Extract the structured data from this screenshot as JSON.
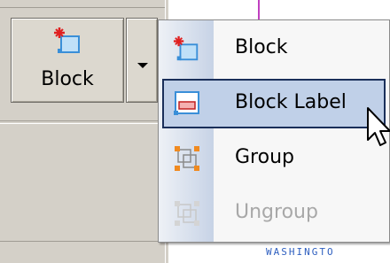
{
  "toolbar": {
    "block_button": {
      "label": "Block",
      "icon": "block-icon"
    },
    "dropdown_icon": "dropdown-arrow-icon"
  },
  "menu": {
    "items": [
      {
        "label": "Block",
        "icon": "block-icon",
        "enabled": true,
        "highlighted": false
      },
      {
        "label": "Block Label",
        "icon": "block-label-icon",
        "enabled": true,
        "highlighted": true
      },
      {
        "label": "Group",
        "icon": "group-icon",
        "enabled": true,
        "highlighted": false
      },
      {
        "label": "Ungroup",
        "icon": "ungroup-icon",
        "enabled": false,
        "highlighted": false
      }
    ]
  },
  "canvas": {
    "text": "WASHINGTO"
  },
  "colors": {
    "highlight_bg": "#c0d0e8",
    "highlight_border": "#1a2f5a",
    "toolbar_bg": "#d4d0c8",
    "block_icon_blue": "#3a8fd8",
    "block_icon_red": "#e02020",
    "group_icon_orange": "#f08a20",
    "disabled_text": "#a8a8a8"
  }
}
